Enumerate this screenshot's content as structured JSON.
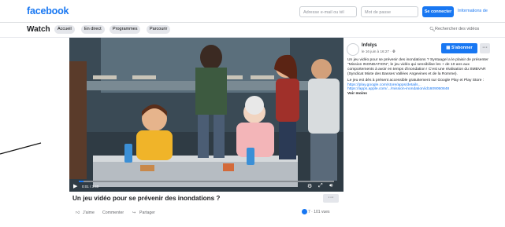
{
  "header": {
    "logo": "facebook",
    "email_placeholder": "Adresse e-mail ou tél",
    "password_placeholder": "Mot de passe",
    "login_label": "Se connecter",
    "info_link": "Informations de"
  },
  "watch": {
    "title": "Watch",
    "tabs": [
      "Accueil",
      "En direct",
      "Programmes",
      "Parcourir"
    ],
    "search_label": "Rechercher des vidéos"
  },
  "video": {
    "time": "0:01 / 3:40",
    "progress": 0.02,
    "title": "Un jeu vidéo pour se prévenir des inondations ?",
    "more": "···",
    "like_label": "J'aime",
    "comment_label": "Commenter",
    "share_label": "Partager",
    "reactions": "7 · 101 vues"
  },
  "post": {
    "page_name": "Infolys",
    "date": "le 16 juin à 16:27 · ",
    "subscribe_label": "S'abonner",
    "more": "···",
    "paragraph1": "Un jeu vidéo pour se prévenir des inondations ? Syntaagel a le plaisir de présenter \"Mission INONDATION\", le jeu vidéo qui sensibilise les + de 10 ans aux comportements à avoir en temps d'inondation ! C'est une réalisation du SMBVAR (Syndicat Mixte des Basses Vallées Angevines et de la Romme).",
    "paragraph2": "Le jeu est dès à présent accessible gratuitement sur Google Play et Play Store :",
    "link1": "https://play.google.com/store/apps/details...",
    "link2": "https://apps.apple.com/.../mission-inondation/id1609050848",
    "see_more": "Voir moins"
  },
  "colors": {
    "brand": "#1877f2",
    "bubble_grey": "#e4e6eb",
    "scene_dark": "#25313a"
  }
}
